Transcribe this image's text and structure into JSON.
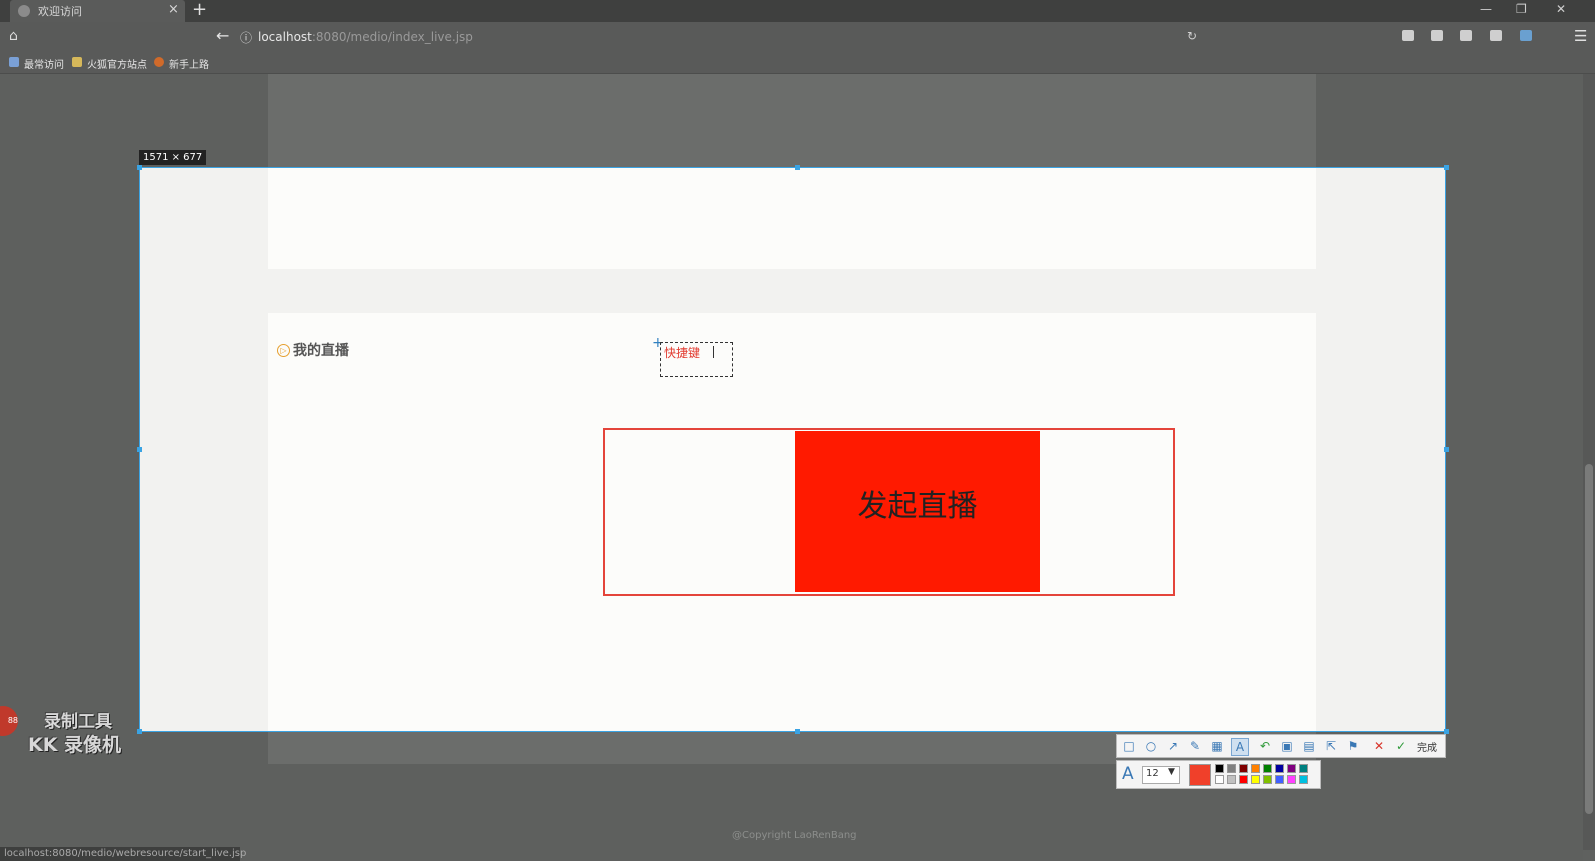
{
  "browser": {
    "tab_title": "欢迎访问",
    "tab_close": "×",
    "new_tab": "+",
    "url_host": "localhost",
    "url_rest": ":8080/medio/index_live.jsp",
    "window_minimize": "—",
    "window_restore": "❐",
    "window_close": "✕",
    "bookmarks": [
      "最常访问",
      "火狐官方站点",
      "新手上路"
    ]
  },
  "page": {
    "section_title": "我的直播",
    "start_live_button": "发起直播",
    "copyright": "@Copyright LaoRenBang",
    "status_url": "localhost:8080/medio/webresource/start_live.jsp"
  },
  "capture": {
    "dimensions": "1571 × 677",
    "annotation_text": "快捷键"
  },
  "toolbar": {
    "done_label": "完成",
    "font_size": "12"
  },
  "watermark": {
    "line1": "录制工具",
    "line2": "KK 录像机",
    "badge": "88"
  },
  "colors": {
    "selected_color": "#f0402a",
    "palette": [
      "#000000",
      "#808080",
      "#800000",
      "#ff8000",
      "#008000",
      "#0000a0",
      "#800080",
      "#008080",
      "#ffffff",
      "#c0c0c0",
      "#ff0000",
      "#ffff00",
      "#80c000",
      "#4060ff",
      "#ff40ff",
      "#00c0e0"
    ]
  }
}
